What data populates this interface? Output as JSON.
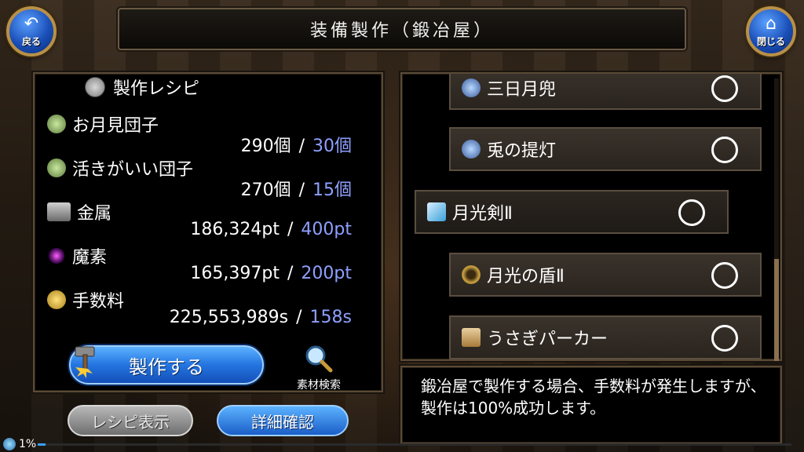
{
  "header": {
    "title": "装備製作（鍛冶屋）",
    "back_label": "戻る",
    "close_label": "閉じる"
  },
  "recipe": {
    "title": "製作レシピ",
    "materials": [
      {
        "name": "お月見団子",
        "owned": "290個",
        "required": "30個",
        "icon": "dumpling-bag-icon"
      },
      {
        "name": "活きがいい団子",
        "owned": "270個",
        "required": "15個",
        "icon": "dumpling-bag-icon"
      },
      {
        "name": "金属",
        "owned": "186,324pt",
        "required": "400pt",
        "icon": "metal-ingot-icon"
      },
      {
        "name": "魔素",
        "owned": "165,397pt",
        "required": "200pt",
        "icon": "magic-orb-icon"
      },
      {
        "name": "手数料",
        "owned": "225,553,989s",
        "required": "158s",
        "icon": "coins-icon"
      }
    ],
    "separator": "/",
    "craft_label": "製作する",
    "search_label": "素材検索",
    "show_recipe_label": "レシピ表示",
    "detail_label": "詳細確認"
  },
  "items": [
    {
      "name": "三日月兜",
      "icon": "helmet-icon"
    },
    {
      "name": "兎の提灯",
      "icon": "helmet-icon"
    },
    {
      "name": "月光剣Ⅱ",
      "icon": "sword-icon",
      "selected": true
    },
    {
      "name": "月光の盾Ⅱ",
      "icon": "shield-icon"
    },
    {
      "name": "うさぎパーカー",
      "icon": "armor-icon"
    }
  ],
  "message": "鍛冶屋で製作する場合、手数料が発生しますが、製作は100%成功します。",
  "status": {
    "percent_label": "1%",
    "progress": 0.01
  },
  "colors": {
    "required_value": "#8ea0ff",
    "accent_blue": "#2474e0"
  }
}
